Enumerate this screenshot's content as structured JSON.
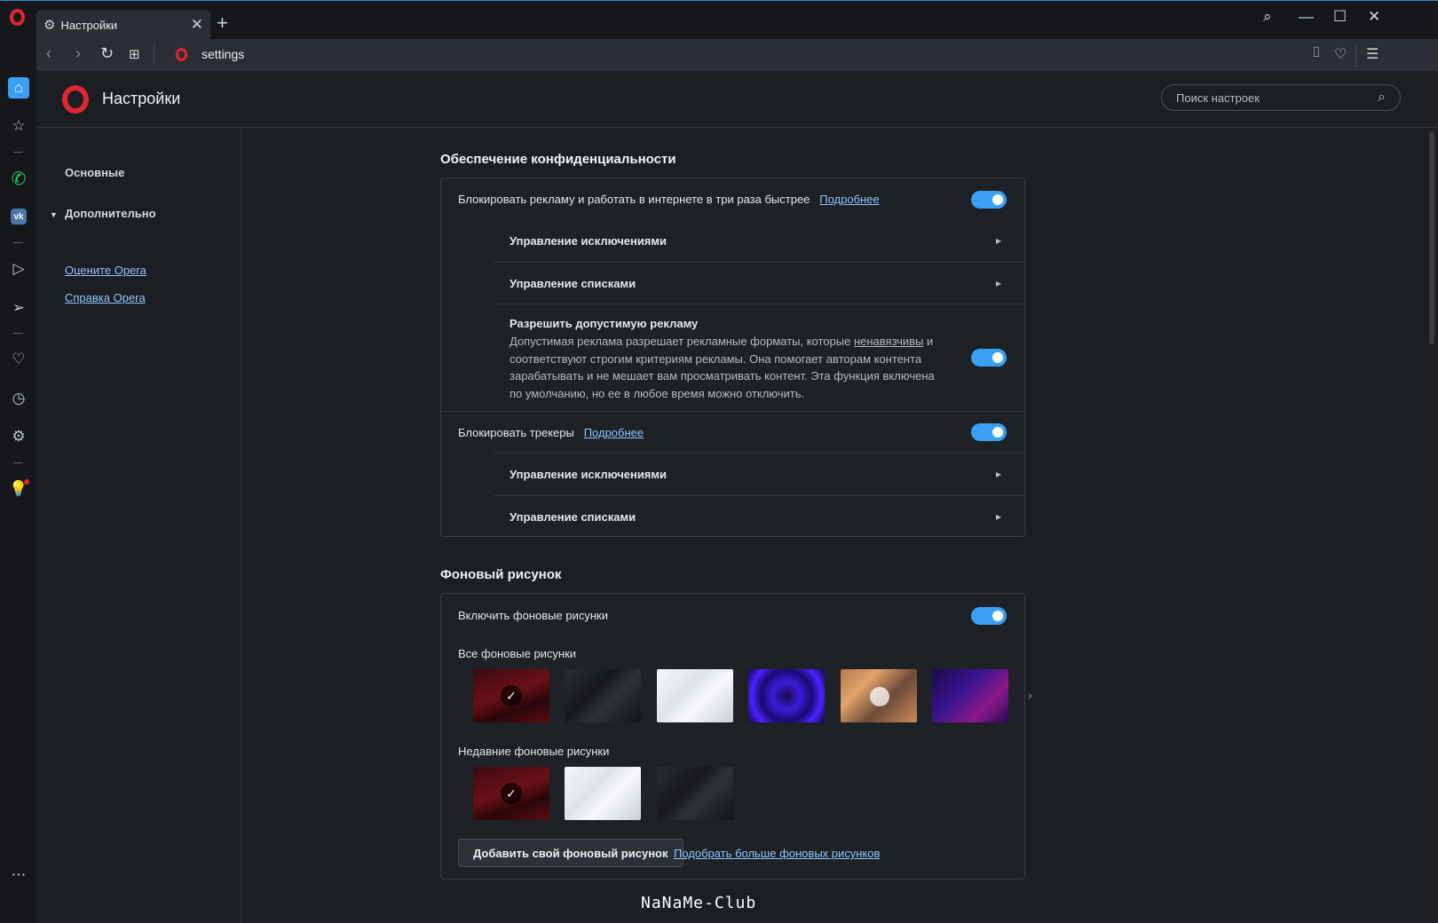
{
  "browser": {
    "tab_title": "Настройки",
    "url": "settings"
  },
  "header": {
    "title": "Настройки",
    "search_placeholder": "Поиск настроек"
  },
  "nav": {
    "basic": "Основные",
    "advanced": "Дополнительно",
    "rate_link": "Оцените Opera",
    "help_link": "Справка Opera"
  },
  "privacy": {
    "title": "Обеспечение конфиденциальности",
    "block_ads_label": "Блокировать рекламу и работать в интернете в три раза быстрее",
    "more_link": "Подробнее",
    "block_ads_enabled": true,
    "manage_exceptions": "Управление исключениями",
    "manage_lists": "Управление списками",
    "acceptable_ads_title": "Разрешить допустимую рекламу",
    "acceptable_ads_desc_1": "Допустимая реклама разрешает рекламные форматы, которые ",
    "acceptable_ads_desc_link": "ненавязчивы",
    "acceptable_ads_desc_2": " и соответствуют строгим критериям рекламы. Она помогает авторам контента зарабатывать и не мешает вам просматривать контент. Эта функция включена по умолчанию, но ее в любое время можно отключить.",
    "acceptable_ads_enabled": true,
    "block_trackers_label": "Блокировать трекеры",
    "block_trackers_enabled": true
  },
  "wallpapers": {
    "title": "Фоновый рисунок",
    "enable_label": "Включить фоновые рисунки",
    "enabled": true,
    "all_label": "Все фоновые рисунки",
    "recent_label": "Недавние фоновые рисунки",
    "add_button": "Добавить свой фоновый рисунок",
    "more_link": "Подобрать больше фоновых рисунков"
  },
  "watermark": "NaNaMe-Club",
  "colors": {
    "accent": "#3aa0f3",
    "opera_red": "#e0262f",
    "background": "#1b1e22"
  }
}
